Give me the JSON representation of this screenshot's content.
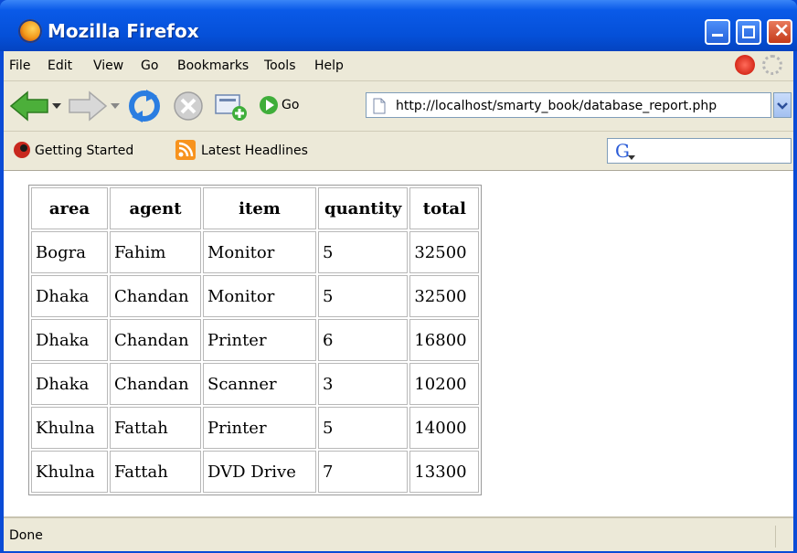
{
  "window": {
    "title": "Mozilla Firefox",
    "icon": "firefox-icon"
  },
  "menubar": {
    "items": [
      {
        "label": "File",
        "accel": "F"
      },
      {
        "label": "Edit",
        "accel": "E"
      },
      {
        "label": "View",
        "accel": "V"
      },
      {
        "label": "Go",
        "accel": "G"
      },
      {
        "label": "Bookmarks",
        "accel": "B"
      },
      {
        "label": "Tools",
        "accel": "T"
      },
      {
        "label": "Help",
        "accel": "H"
      }
    ]
  },
  "navbar": {
    "go_label": "Go",
    "url": "http://localhost/smarty_book/database_report.php"
  },
  "bookmarks": {
    "items": [
      "Getting Started",
      "Latest Headlines"
    ]
  },
  "search": {
    "engine_letter": "G"
  },
  "table": {
    "headers": [
      "area",
      "agent",
      "item",
      "quantity",
      "total"
    ],
    "rows": [
      [
        "Bogra",
        "Fahim",
        "Monitor",
        "5",
        "32500"
      ],
      [
        "Dhaka",
        "Chandan",
        "Monitor",
        "5",
        "32500"
      ],
      [
        "Dhaka",
        "Chandan",
        "Printer",
        "6",
        "16800"
      ],
      [
        "Dhaka",
        "Chandan",
        "Scanner",
        "3",
        "10200"
      ],
      [
        "Khulna",
        "Fattah",
        "Printer",
        "5",
        "14000"
      ],
      [
        "Khulna",
        "Fattah",
        "DVD Drive",
        "7",
        "13300"
      ]
    ]
  },
  "status": {
    "text": "Done"
  },
  "colors": {
    "titlebar": "#0550d8",
    "chrome": "#ece9d8",
    "close_button": "#c43b1a",
    "rss": "#f7931e"
  }
}
